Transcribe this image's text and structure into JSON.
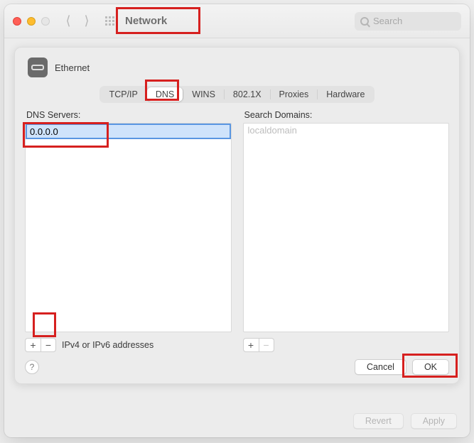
{
  "window": {
    "title": "Network",
    "search_placeholder": "Search"
  },
  "sheet": {
    "service_name": "Ethernet",
    "tabs": [
      "TCP/IP",
      "DNS",
      "WINS",
      "802.1X",
      "Proxies",
      "Hardware"
    ],
    "active_tab_index": 1,
    "dns": {
      "label": "DNS Servers:",
      "editing_value": "0.0.0.0",
      "hint": "IPv4 or IPv6 addresses",
      "add_label": "+",
      "remove_label": "−"
    },
    "domains": {
      "label": "Search Domains:",
      "items": [
        "localdomain"
      ],
      "add_label": "+",
      "remove_label": "−"
    },
    "help_label": "?",
    "cancel_label": "Cancel",
    "ok_label": "OK"
  },
  "footer": {
    "revert_label": "Revert",
    "apply_label": "Apply"
  }
}
